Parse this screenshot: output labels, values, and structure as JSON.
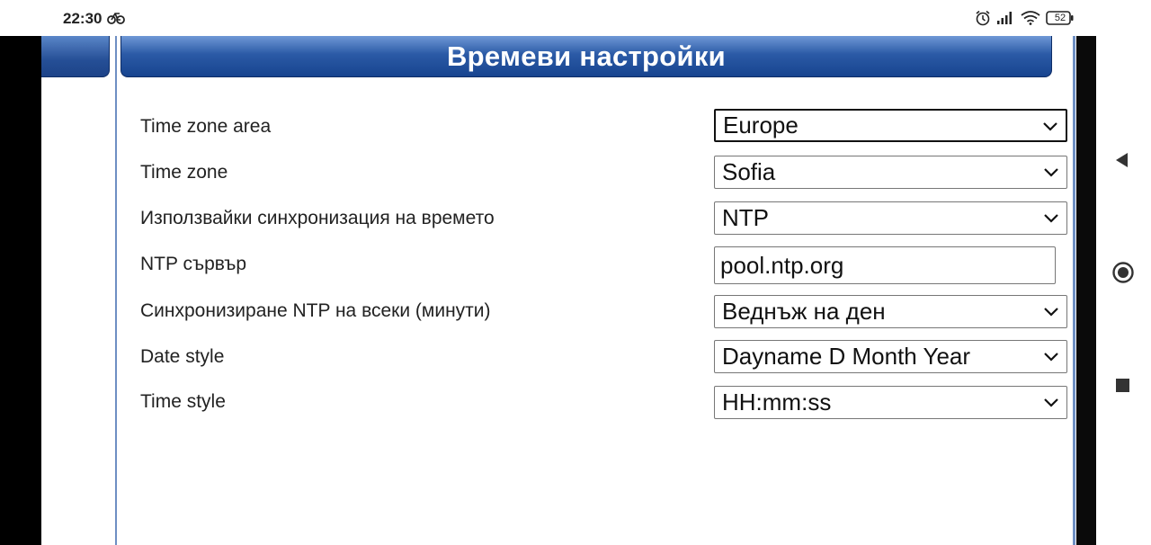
{
  "status_bar": {
    "time": "22:30",
    "battery": "52",
    "icons": [
      "bike-icon",
      "alarm-icon",
      "signal-icon",
      "wifi-icon",
      "battery-icon"
    ]
  },
  "header": {
    "title": "Времеви настройки"
  },
  "settings": [
    {
      "label": "Time zone area",
      "type": "select",
      "value": "Europe"
    },
    {
      "label": "Time zone",
      "type": "select",
      "value": "Sofia"
    },
    {
      "label": "Използвайки синхронизация на времето",
      "type": "select",
      "value": "NTP"
    },
    {
      "label": "NTP сървър",
      "type": "text",
      "value": "pool.ntp.org"
    },
    {
      "label": "Синхронизиране NTP на всеки (минути)",
      "type": "select",
      "value": "Веднъж на ден"
    },
    {
      "label": "Date style",
      "type": "select",
      "value": "Dayname D Month Year"
    },
    {
      "label": "Time style",
      "type": "select",
      "value": "HH:mm:ss"
    }
  ],
  "nav_bar": {
    "icons": [
      "back-icon",
      "home-icon",
      "recents-icon"
    ]
  },
  "colors": {
    "header_blue": "#2b5aa6",
    "border_blue": "#6e8fc3"
  }
}
